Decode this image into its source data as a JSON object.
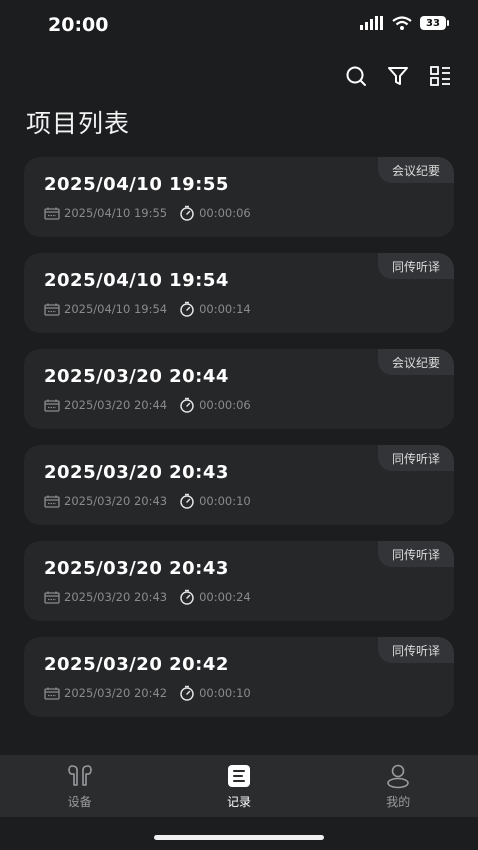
{
  "status": {
    "time": "20:00",
    "battery": "33"
  },
  "page": {
    "title": "项目列表"
  },
  "records": [
    {
      "title": "2025/04/10 19:55",
      "date": "2025/04/10 19:55",
      "duration": "00:00:06",
      "tag": "会议纪要"
    },
    {
      "title": "2025/04/10 19:54",
      "date": "2025/04/10 19:54",
      "duration": "00:00:14",
      "tag": "同传听译"
    },
    {
      "title": "2025/03/20 20:44",
      "date": "2025/03/20 20:44",
      "duration": "00:00:06",
      "tag": "会议纪要"
    },
    {
      "title": "2025/03/20 20:43",
      "date": "2025/03/20 20:43",
      "duration": "00:00:10",
      "tag": "同传听译"
    },
    {
      "title": "2025/03/20 20:43",
      "date": "2025/03/20 20:43",
      "duration": "00:00:24",
      "tag": "同传听译"
    },
    {
      "title": "2025/03/20 20:42",
      "date": "2025/03/20 20:42",
      "duration": "00:00:10",
      "tag": "同传听译"
    }
  ],
  "tabs": [
    {
      "label": "设备",
      "icon": "earbuds-icon"
    },
    {
      "label": "记录",
      "icon": "record-book-icon"
    },
    {
      "label": "我的",
      "icon": "user-icon"
    }
  ],
  "toolbar": {
    "icons": [
      "search-icon",
      "filter-icon",
      "layout-list-icon"
    ]
  },
  "colors": {
    "background": "#1c1d1f",
    "card": "#262729",
    "badge": "#333437",
    "tabbar": "#2b2c2e"
  }
}
